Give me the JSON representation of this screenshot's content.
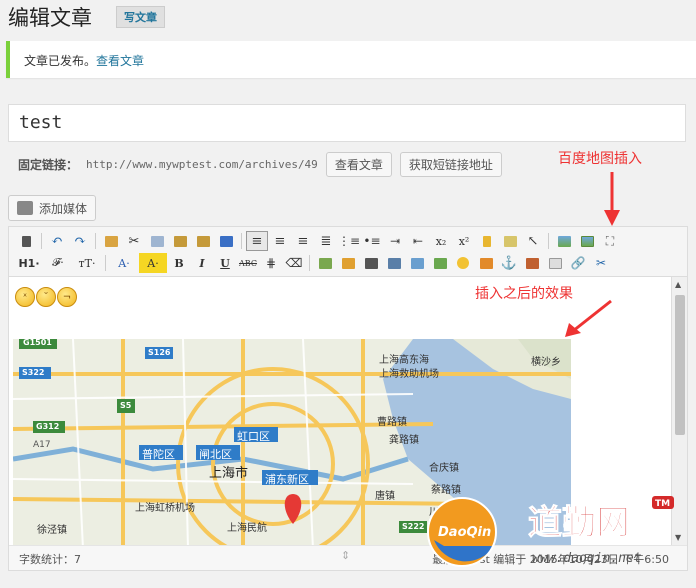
{
  "header": {
    "title": "编辑文章",
    "add_new": "写文章"
  },
  "notice": {
    "text": "文章已发布。",
    "link": "查看文章"
  },
  "post": {
    "title_value": "test"
  },
  "permalink": {
    "label": "固定链接：",
    "url": "http://www.mywptest.com/archives/49",
    "view_button": "查看文章",
    "shortlink_button": "获取短链接地址"
  },
  "annotations": {
    "baidu_map_insert": "百度地图插入",
    "after_insert": "插入之后的效果"
  },
  "media": {
    "add_media": "添加媒体"
  },
  "toolbar": {
    "row1_icons": [
      "kitchen-sink-icon",
      "undo-icon",
      "redo-icon",
      "paste-text-icon",
      "cut-icon",
      "copy-icon",
      "paste-icon",
      "paste-text-icon-2",
      "paste-word-icon",
      "align-left-icon",
      "align-center-icon",
      "align-right-icon",
      "align-justify-icon",
      "ordered-list-icon",
      "unordered-list-icon",
      "indent-icon",
      "outdent-icon",
      "subscript-icon",
      "superscript-icon",
      "clean-icon",
      "format-painter-icon",
      "select-icon",
      "image-icon",
      "baidu-map-icon",
      "fullscreen-icon"
    ],
    "row2_labels": {
      "heading": "H1·",
      "font": "𝓕·",
      "size": "тT·",
      "color": "A·",
      "bg": "A·",
      "bold": "B",
      "italic": "I",
      "underline": "U",
      "strike": "ABC"
    }
  },
  "content": {
    "smileys": [
      "😵",
      "😝",
      "😏"
    ]
  },
  "map": {
    "labels": [
      {
        "t": "G1501"
      },
      {
        "t": "S126"
      },
      {
        "t": "S322"
      },
      {
        "t": "S5"
      },
      {
        "t": "G312"
      },
      {
        "t": "A17"
      },
      {
        "t": "普陀区"
      },
      {
        "t": "闸北区"
      },
      {
        "t": "虹口区"
      },
      {
        "t": "上海市"
      },
      {
        "t": "浦东新区"
      },
      {
        "t": "上海虹桥机场"
      },
      {
        "t": "徐泾镇"
      },
      {
        "t": "上海民航"
      },
      {
        "t": "上海高东海"
      },
      {
        "t": "上海救助机场"
      },
      {
        "t": "曹路镇"
      },
      {
        "t": "龚路镇"
      },
      {
        "t": "合庆镇"
      },
      {
        "t": "唐镇"
      },
      {
        "t": "蔡路镇"
      },
      {
        "t": "川沙新镇"
      },
      {
        "t": "S222"
      },
      {
        "t": "横沙乡"
      }
    ]
  },
  "status": {
    "word_count": "字数统计：7",
    "last_edit": "最后由 test 编辑于 2015年10月23日 下午6:50"
  },
  "watermark": {
    "brand": "道勤网",
    "logo_text": "DaoQin",
    "url": "www.daoqin.net",
    "tm": "TM"
  }
}
